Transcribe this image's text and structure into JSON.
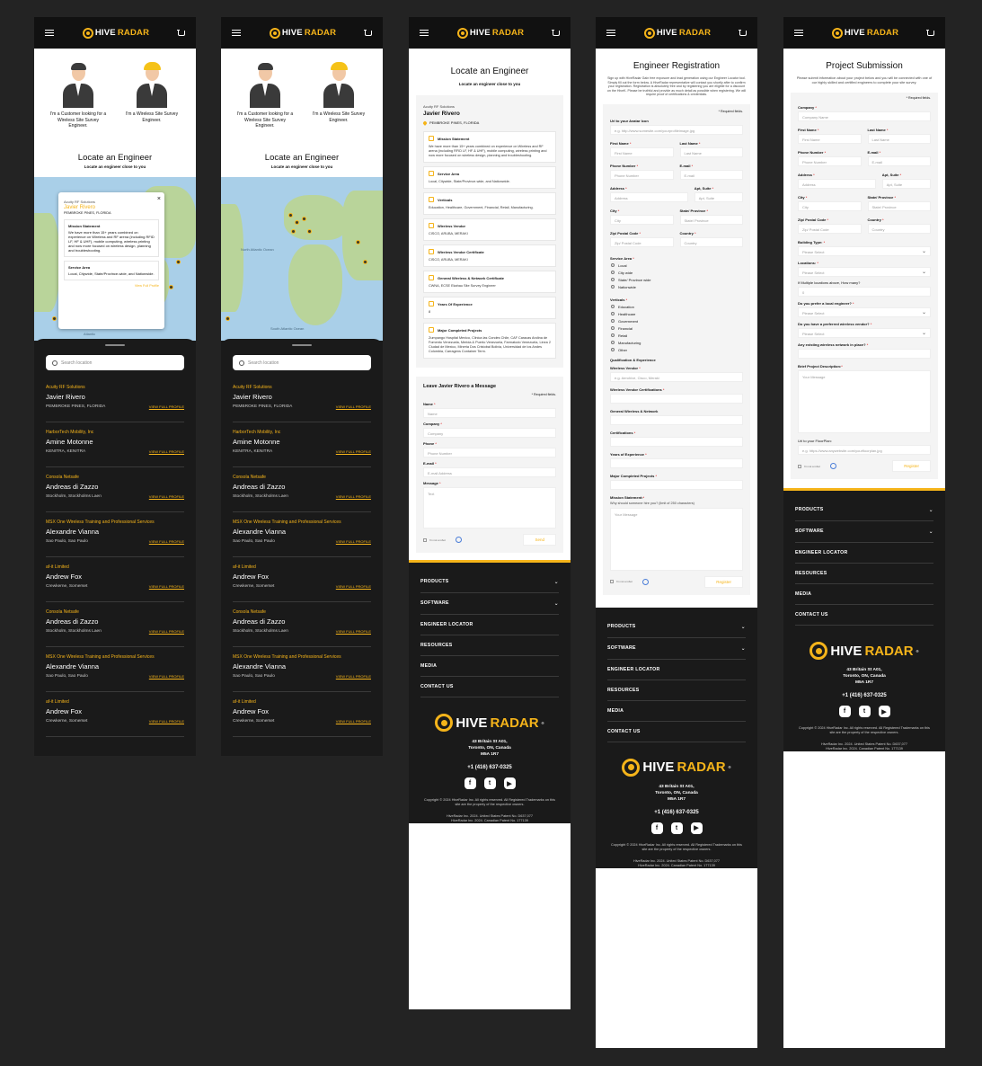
{
  "brand": {
    "hive": "HIVE",
    "radar": "RADAR",
    "reg": "®"
  },
  "chooser": {
    "customer": "I'm a Customer looking for a Wireless Site Survey Engineer.",
    "engineer": "I'm a Wireless Site Survey Engineer."
  },
  "locate": {
    "title": "Locate an Engineer",
    "subtitle": "Locate an engineer close to you"
  },
  "map": {
    "labels": {
      "north_atlantic": "North Atlantic Ocean",
      "south_atlantic": "South Atlantic Ocean",
      "atlantic": "Atlantic"
    }
  },
  "popup": {
    "company": "Acuity RF Solutions",
    "name": "Javier Rivero",
    "address": "PEMBROKE PINES, FLORIDA",
    "mission_title": "Mission Statement",
    "mission_text": "We have more than 15+ years combined on experience on Wireless and RF arena (including RFID LF, HF & UHF), mobile computing, wireless printing and now more focused on wireless design, planning and troubleshooting.",
    "service_title": "Service Area",
    "service_text": "Local, Citywide, State/Province-wide, and Nationwide.",
    "link": "View Full Profile"
  },
  "search": {
    "placeholder": "Search location"
  },
  "engineers": [
    {
      "company": "Acuity RF Solutions",
      "name": "Javier Rivero",
      "location": "PEMBROKE PINES, FLORIDA"
    },
    {
      "company": "HarborTech Mobility, Inc",
      "name": "Amine Motonne",
      "location": "KENITRA, KENITRA"
    },
    {
      "company": "Consola Netsafe",
      "name": "Andreas di Zazzo",
      "location": "Stockholm, Stockholms Laen"
    },
    {
      "company": "MSX One Wireless Training and Professional Services",
      "name": "Alexandre Vianna",
      "location": "Sao Paulo, Sao Paulo"
    },
    {
      "company": "af-it Limited",
      "name": "Andrew Fox",
      "location": "Crewkerne, Somerset"
    },
    {
      "company": "Consola Netsafe",
      "name": "Andreas di Zazzo",
      "location": "Stockholm, Stockholms Laen"
    },
    {
      "company": "MSX One Wireless Training and Professional Services",
      "name": "Alexandre Vianna",
      "location": "Sao Paulo, Sao Paulo"
    },
    {
      "company": "af-it Limited",
      "name": "Andrew Fox",
      "location": "Crewkerne, Somerset"
    }
  ],
  "view_full_profile": "VIEW FULL PROFILE",
  "profile": {
    "title": "Locate an Engineer",
    "subtitle": "Locate an engineer close to you",
    "company": "Acuity RF Solutions",
    "name": "Javier Rivero",
    "address": "PEMBROKE PINES, FLORIDA",
    "sections": [
      {
        "title": "Mission Statement",
        "text": "We have more than 15+ years combined on experience on Wireless and RF arena (including RFID LF, HF & UHF), mobile computing, wireless printing and now more focused on wireless design, planning and troubleshooting."
      },
      {
        "title": "Service Area",
        "text": "Local, Citywide, State/Province-wide, and Nationwide."
      },
      {
        "title": "Verticals",
        "text": "Education, Healthcare, Government, Financial, Retail, Manufacturing."
      },
      {
        "title": "Wireless Vendor",
        "text": "CISCO, ARUBA, MERAKI"
      },
      {
        "title": "Wireless Vendor Certificate",
        "text": "CISCO, ARUBA, MERAKI"
      },
      {
        "title": "General Wireless & Network Certificate",
        "text": "CWNA, ECSE Ekahau Site Survey Engineer"
      },
      {
        "title": "Years Of Experience",
        "text": "8"
      },
      {
        "title": "Major Completed Projects",
        "text": "Zumpango Hospital Mexico, Clinica las Condes Chile, CAF Caracas Andina de Fomento Venezuela, Merida & Puerto Venezuela, Farmatodo Venezuela, Linea 2 Ciudad de Mexico, Mineria Dos Cristobal Bolivia, Universidad de los Andes Colombia, Carragens Container Term."
      }
    ]
  },
  "message_form": {
    "title": "Leave Javier Rivero a Message",
    "required": "* Required fields.",
    "name_label": "Name",
    "name_ph": "Name",
    "company_label": "Company",
    "company_ph": "Company",
    "phone_label": "Phone",
    "phone_ph": "Phone Number",
    "email_label": "E-mail",
    "email_ph": "E-mail Address",
    "message_label": "Message",
    "message_ph": "Text",
    "captcha": "I'm not a robot",
    "send": "Send"
  },
  "registration": {
    "title": "Engineer Registration",
    "intro": "Sign up with HiveRadar Gain free exposure and lead generation using our Engineer Locator tool. Simply fill out the form below. A HiveRadar representative will contact you shortly after to confirm your registration. Registration is absolutely free and by registering you are eligible for a discount on the HiveK. Please be truthful and provide as much detail as possible when registering. We will require proof of certifications & credentials.",
    "required": "* Required fields.",
    "avatar_label": "Url to your Avatar Icon",
    "avatar_ph": "e.g. http://www.somesite.com/yourprofileimage.jpg",
    "first_label": "First Name",
    "first_ph": "First Name",
    "last_label": "Last Name",
    "last_ph": "Last Name",
    "phone_label": "Phone Number",
    "phone_ph": "Phone Number",
    "email_label": "E-mail",
    "email_ph": "E-mail",
    "address_label": "Address",
    "address_ph": "Address",
    "apt_label": "Apt, Suite",
    "apt_ph": "Apt, Suite",
    "city_label": "City",
    "city_ph": "City",
    "state_label": "State/ Province",
    "state_ph": "State/ Province",
    "zip_label": "Zip/ Postal Code",
    "zip_ph": "Zip/ Postal Code",
    "country_label": "Country",
    "country_ph": "Country",
    "service_label": "Service Area",
    "service_options": [
      "Local",
      "City wide",
      "State/ Province wide",
      "Nationwide"
    ],
    "verticals_label": "Verticals",
    "verticals_options": [
      "Education",
      "Healthcare",
      "Government",
      "Financial",
      "Retail",
      "Manufacturing",
      "Other"
    ],
    "qual_label": "Qualification & Experience",
    "vendor_label": "Wireless Vendor",
    "vendor_ph": "e.g. Aerohive, Cisco, Meraki",
    "vendor_cert_label": "Wireless Vendor Certifications",
    "general_label": "General Wireless & Network",
    "certs_label": "Certifications",
    "years_label": "Years of Experience",
    "projects_label": "Major Completed Projects",
    "mission_label": "Mission Statement:",
    "mission_hint": "Why should someone hire you? (limit of 250 characters)",
    "mission_ph": "Your Message",
    "captcha": "I'm not a robot",
    "register": "Register"
  },
  "project": {
    "title": "Project Submission",
    "intro": "Please submit information about your project below and you will be connected with one of our highly skilled and certified engineers to complete your site survey.",
    "required": "* Required fields.",
    "company_label": "Company",
    "company_ph": "Company Name",
    "first_label": "First Name",
    "first_ph": "First Name",
    "last_label": "Last Name",
    "last_ph": "Last Name",
    "phone_label": "Phone Number",
    "phone_ph": "Phone Number",
    "email_label": "E-mail",
    "email_ph": "E-mail",
    "address_label": "Address",
    "address_ph": "Address",
    "apt_label": "Apt, Suite",
    "apt_ph": "Apt, Suite",
    "city_label": "City",
    "city_ph": "City",
    "state_label": "State/ Province",
    "state_ph": "State/ Province",
    "zip_label": "Zip/ Postal Code",
    "zip_ph": "Zip/ Postal Code",
    "country_label": "Country",
    "country_ph": "Country",
    "building_label": "Building Type:",
    "select_ph": "Please Select",
    "locations_label": "Locations:",
    "how_many_label": "If Multiple locations above, How many?",
    "how_many_value": "0",
    "local_vendor_label": "Do you prefer a local engineer?",
    "pref_vendor_label": "Do you have a preferred wireless vendor?",
    "existing_label": "Any existing wireless network in place?",
    "desc_label": "Brief Project Description:",
    "desc_ph": "Your Message",
    "floor_label": "Url to your FloorPlan:",
    "floor_ph": "e.g. https://www.anywebsite.com/yourfloorplan.jpg",
    "captcha": "I'm not a robot",
    "register": "Register"
  },
  "footer": {
    "menu": [
      "PRODUCTS",
      "SOFTWARE",
      "ENGINEER LOCATOR",
      "RESOURCES",
      "MEDIA",
      "CONTACT US"
    ],
    "address1": "43 Britain St A01,",
    "address2": "Toronto, ON, Canada",
    "address3": "M5A 1R7",
    "phone": "+1 (416) 637-0325",
    "social": [
      "f",
      "t",
      "▶"
    ],
    "copyright": "Copyright © 2024 HiveRadar Inc. All rights reserved. All Registered Trademarks on this site are the property of the respective owners.",
    "patent1": "HiveRadar Inc. 2024. United States Patent No. D637,077",
    "patent2": "HiveRadar Inc. 2024. Canadian Patent No. 177139"
  },
  "colors": {
    "accent": "#f5b41a",
    "dark": "#1a1a1a",
    "page_bg": "#232323"
  }
}
